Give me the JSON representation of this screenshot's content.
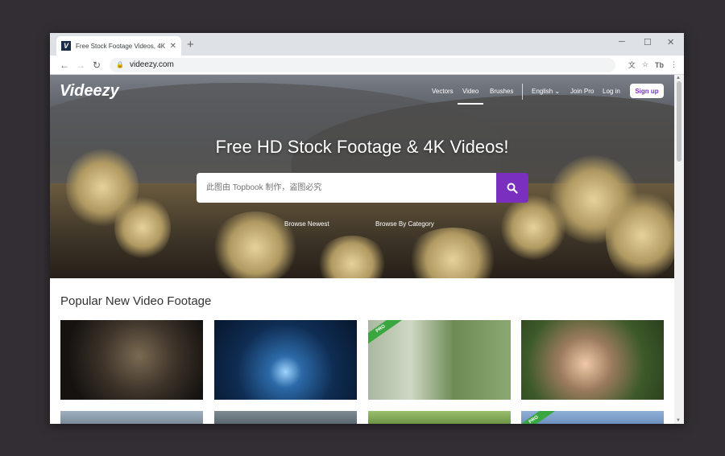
{
  "browser": {
    "tab_title": "Free Stock Footage Videos, 4K",
    "favicon_letter": "V",
    "url": "videezy.com",
    "profile_initials": "Tb"
  },
  "site": {
    "logo": "Videezy",
    "nav": [
      "Vectors",
      "Video",
      "Brushes"
    ],
    "active_nav": "Video",
    "language": "English",
    "join_pro": "Join Pro",
    "login": "Log in",
    "signup": "Sign up"
  },
  "hero": {
    "title": "Free HD Stock Footage & 4K Videos!",
    "search_placeholder": "此图由 Topbook 制作，盗图必究",
    "browse_newest": "Browse Newest",
    "browse_category": "Browse By Category"
  },
  "section": {
    "title": "Popular New Video Footage",
    "pro_badge": "PRO"
  },
  "colors": {
    "accent": "#7b2fbe",
    "pro_badge": "#3aa640"
  }
}
